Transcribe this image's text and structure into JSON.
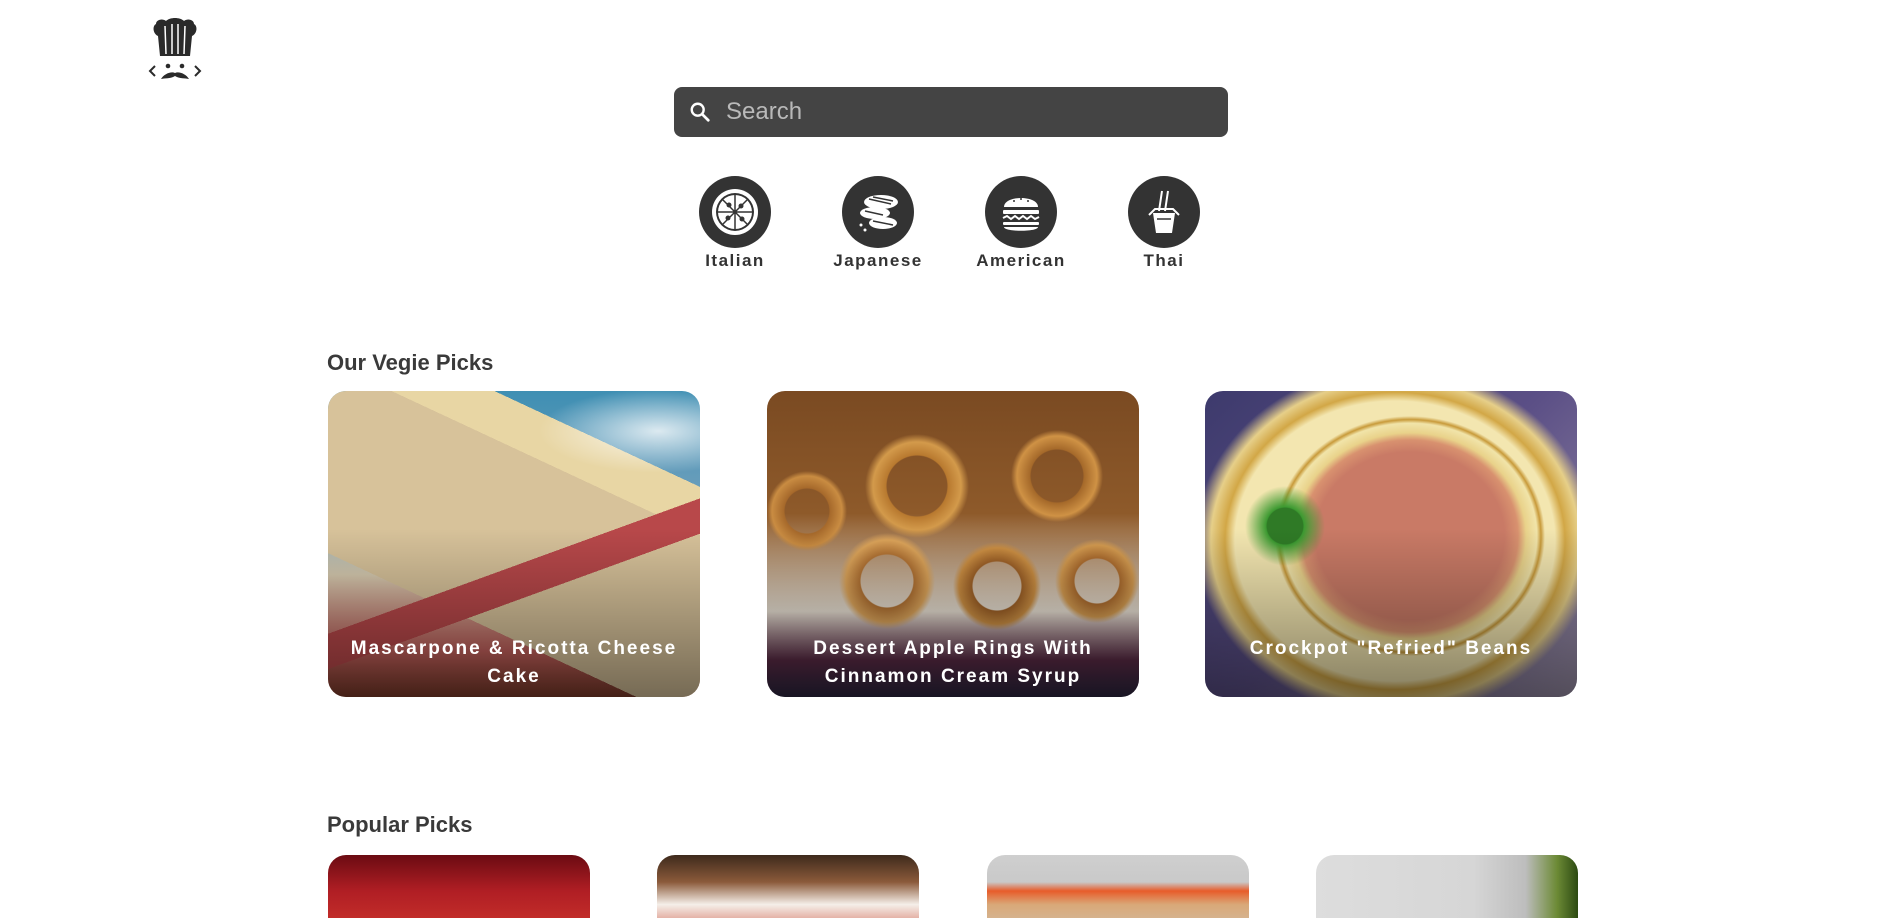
{
  "search": {
    "placeholder": "Search",
    "value": ""
  },
  "categories": [
    {
      "label": "Italian",
      "icon": "pizza-icon"
    },
    {
      "label": "Japanese",
      "icon": "sushi-icon"
    },
    {
      "label": "American",
      "icon": "burger-icon"
    },
    {
      "label": "Thai",
      "icon": "noodle-box-icon"
    }
  ],
  "vegie": {
    "title": "Our Vegie Picks",
    "cards": [
      {
        "title": "Mascarpone & Ricotta Cheese Cake"
      },
      {
        "title": "Dessert Apple Rings With Cinnamon Cream Syrup"
      },
      {
        "title": "Crockpot \"Refried\" Beans"
      }
    ]
  },
  "popular": {
    "title": "Popular Picks"
  },
  "colors": {
    "search_bg": "#444444",
    "category_bg": "#333333",
    "heading": "#3a3a3a"
  }
}
